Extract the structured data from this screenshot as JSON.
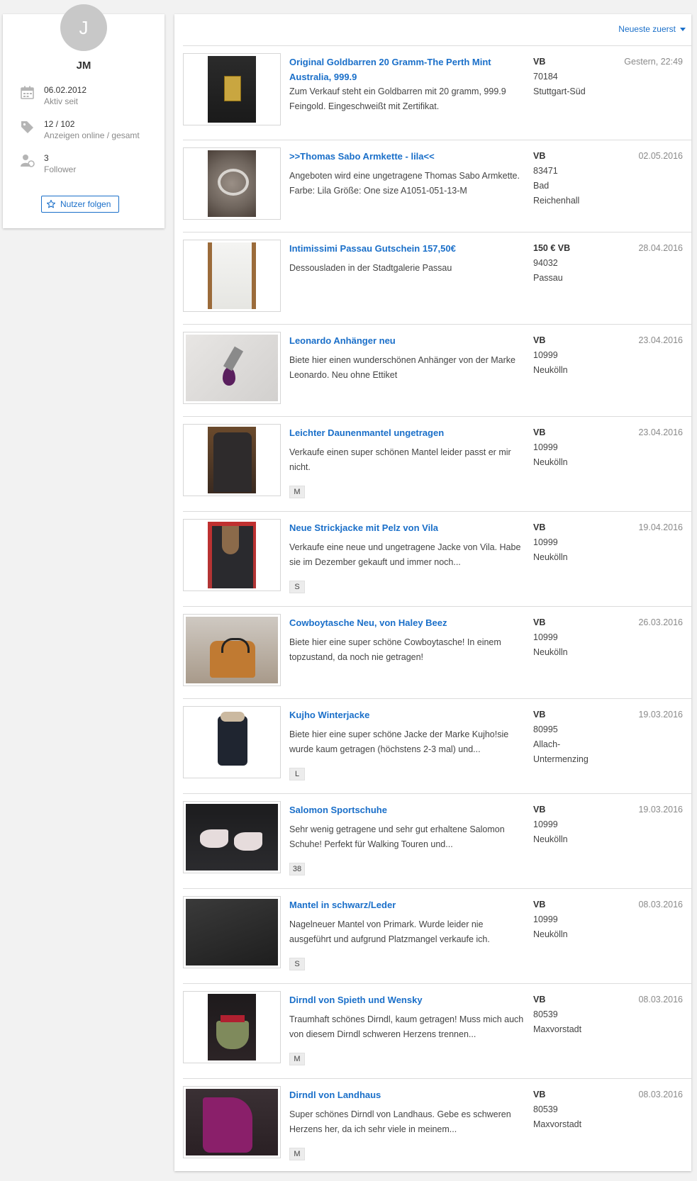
{
  "profile": {
    "avatar_letter": "J",
    "name": "JM",
    "active_since_value": "06.02.2012",
    "active_since_label": "Aktiv seit",
    "ads_value": "12 / 102",
    "ads_label": "Anzeigen online / gesamt",
    "followers_value": "3",
    "followers_label": "Follower",
    "follow_button_label": "Nutzer folgen"
  },
  "sort": {
    "label": "Neueste zuerst"
  },
  "colors": {
    "link": "#1a6fc9",
    "background": "#f2f2f2",
    "muted": "#8a8a8a"
  },
  "listings": [
    {
      "title": "Original Goldbarren 20 Gramm-The Perth Mint Australia, 999.9",
      "description": "Zum Verkauf steht ein Goldbarren mit 20 gramm, 999.9 Feingold. Eingeschweißt mit Zertifikat.",
      "price": "VB",
      "location": "70184\nStuttgart-Süd",
      "date": "Gestern, 22:49",
      "tag": ""
    },
    {
      "title": ">>Thomas Sabo Armkette - lila<<",
      "description": "Angeboten wird eine ungetragene Thomas Sabo Armkette. Farbe: Lila Größe: One size A1051-051-13-M",
      "price": "VB",
      "location": "83471\nBad\nReichenhall",
      "date": "02.05.2016",
      "tag": ""
    },
    {
      "title": "Intimissimi Passau Gutschein 157,50€",
      "description": "Dessousladen in der Stadtgalerie Passau",
      "price": "150 € VB",
      "location": "94032\nPassau",
      "date": "28.04.2016",
      "tag": ""
    },
    {
      "title": "Leonardo Anhänger neu",
      "description": "Biete hier einen wunderschönen Anhänger von der Marke Leonardo. Neu ohne Ettiket",
      "price": "VB",
      "location": "10999\nNeukölln",
      "date": "23.04.2016",
      "tag": ""
    },
    {
      "title": "Leichter Daunenmantel ungetragen",
      "description": "Verkaufe einen super schönen Mantel leider passt er mir nicht.",
      "price": "VB",
      "location": "10999\nNeukölln",
      "date": "23.04.2016",
      "tag": "M"
    },
    {
      "title": "Neue Strickjacke mit Pelz von Vila",
      "description": "Verkaufe eine neue und ungetragene Jacke von Vila. Habe sie im Dezember gekauft und immer noch...",
      "price": "VB",
      "location": "10999\nNeukölln",
      "date": "19.04.2016",
      "tag": "S"
    },
    {
      "title": "Cowboytasche Neu, von Haley Beez",
      "description": "Biete hier eine super schöne Cowboytasche! In einem topzustand, da noch nie getragen!",
      "price": "VB",
      "location": "10999\nNeukölln",
      "date": "26.03.2016",
      "tag": ""
    },
    {
      "title": "Kujho Winterjacke",
      "description": "Biete hier eine super schöne Jacke der Marke Kujho!sie wurde kaum getragen (höchstens 2-3 mal) und...",
      "price": "VB",
      "location": "80995\nAllach-\nUntermenzing",
      "date": "19.03.2016",
      "tag": "L"
    },
    {
      "title": "Salomon Sportschuhe",
      "description": "Sehr wenig getragene und sehr gut erhaltene Salomon Schuhe! Perfekt für Walking Touren und...",
      "price": "VB",
      "location": "10999\nNeukölln",
      "date": "19.03.2016",
      "tag": "38"
    },
    {
      "title": "Mantel in schwarz/Leder",
      "description": "Nagelneuer Mantel von Primark. Wurde leider nie ausgeführt und aufgrund Platzmangel verkaufe ich.",
      "price": "VB",
      "location": "10999\nNeukölln",
      "date": "08.03.2016",
      "tag": "S"
    },
    {
      "title": "Dirndl von Spieth und Wensky",
      "description": "Traumhaft schönes Dirndl, kaum getragen! Muss mich auch von diesem Dirndl schweren Herzens trennen...",
      "price": "VB",
      "location": "80539\nMaxvorstadt",
      "date": "08.03.2016",
      "tag": "M"
    },
    {
      "title": "Dirndl von Landhaus",
      "description": "Super schönes Dirndl von Landhaus. Gebe es schweren Herzens her, da ich sehr viele in meinem...",
      "price": "VB",
      "location": "80539\nMaxvorstadt",
      "date": "08.03.2016",
      "tag": "M"
    }
  ]
}
